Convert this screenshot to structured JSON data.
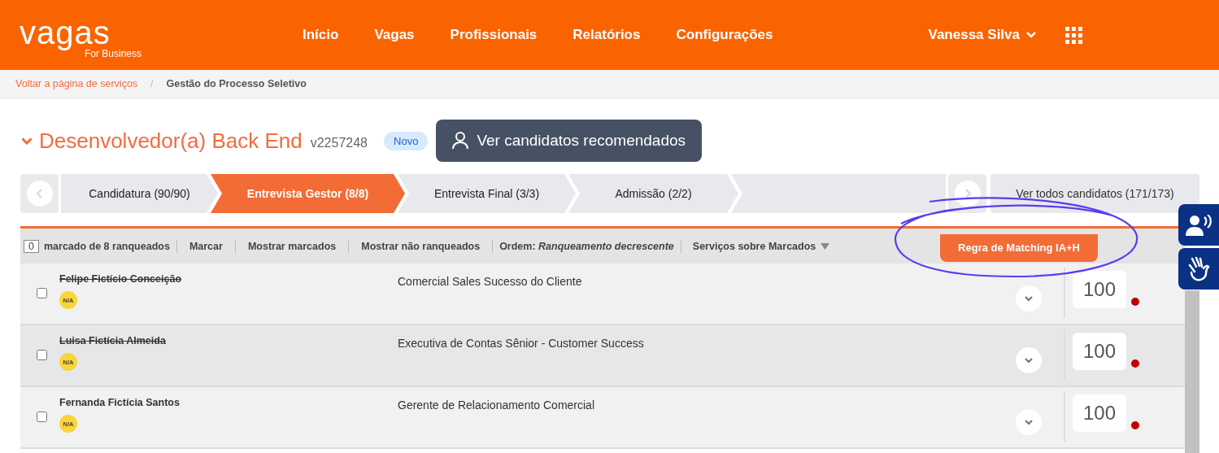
{
  "header": {
    "logo": "vagas",
    "logo_sub": "For Business",
    "nav": [
      "Início",
      "Vagas",
      "Profissionais",
      "Relatórios",
      "Configurações"
    ],
    "user": "Vanessa Silva"
  },
  "breadcrumb_separator": "/",
  "breadcrumb": [
    {
      "label": "Voltar a página de serviços",
      "kind": "link"
    },
    {
      "label": "Gestão do Processo Seletivo",
      "kind": "current"
    }
  ],
  "job": {
    "title": "Desenvolvedor(a) Back End",
    "code": "v2257248",
    "badge": "Novo",
    "recommend_button": "Ver candidatos recomendados"
  },
  "stages": [
    {
      "label": "Candidatura (90/90)",
      "selected": false
    },
    {
      "label": "Entrevista Gestor (8/8)",
      "selected": true
    },
    {
      "label": "Entrevista Final (3/3)",
      "selected": false
    },
    {
      "label": "Admissão (2/2)",
      "selected": false
    }
  ],
  "all_candidates": "Ver todos candidatos (171/173)",
  "toolbar": {
    "marked_count": "0",
    "marked_label": "marcado de 8 ranqueados",
    "actions": [
      "Marcar",
      "Mostrar marcados",
      "Mostrar não ranqueados"
    ],
    "order_label": "Ordem:",
    "order_value": "Ranqueamento decrescente",
    "services": "Serviços sobre Marcados",
    "matching_button": "Regra de Matching IA+H"
  },
  "candidates": [
    {
      "name": "Felipe Fictício Conceição",
      "struck": true,
      "badge": "N/A",
      "role": "Comercial Sales Sucesso do Cliente",
      "score": "100",
      "checked": false
    },
    {
      "name": "Luisa Fictícia Almeida",
      "struck": true,
      "badge": "N/A",
      "role": "Executiva de Contas Sênior - Customer Success",
      "score": "100",
      "checked": false
    },
    {
      "name": "Fernanda Fictícia Santos",
      "struck": false,
      "badge": "N/A",
      "role": "Gerente de Relacionamento Comercial",
      "score": "100",
      "checked": false
    }
  ]
}
